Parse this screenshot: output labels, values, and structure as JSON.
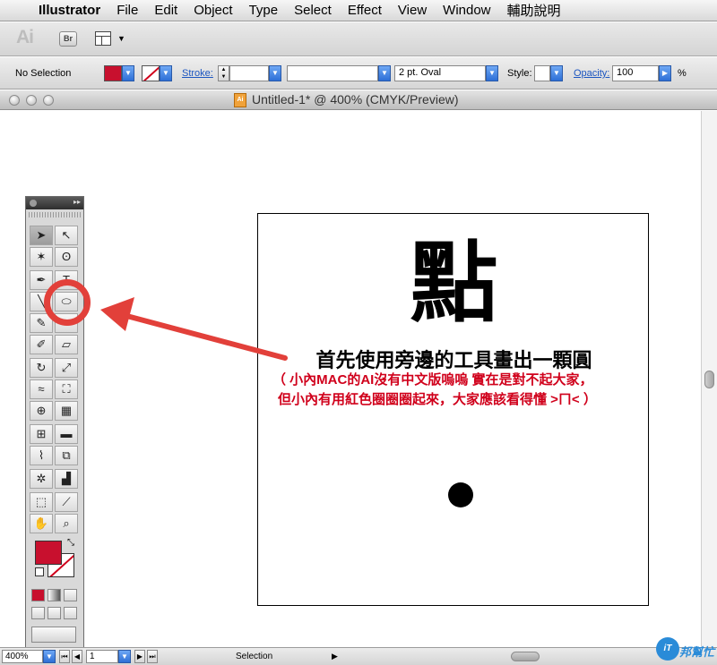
{
  "menubar": {
    "app_name": "Illustrator",
    "items": [
      "File",
      "Edit",
      "Object",
      "Type",
      "Select",
      "Effect",
      "View",
      "Window",
      "輔助說明"
    ]
  },
  "appbar": {
    "logo_text": "Ai",
    "bridge_label": "Br"
  },
  "controlbar": {
    "selection_status": "No Selection",
    "stroke_label": "Stroke:",
    "brush_value": "2 pt. Oval",
    "style_label": "Style:",
    "opacity_label": "Opacity:",
    "opacity_value": "100",
    "opacity_unit": "%",
    "fill_color": "#c8102e"
  },
  "document": {
    "title": "Untitled-1* @ 400% (CMYK/Preview)",
    "icon_label": "Ai"
  },
  "artboard": {
    "big_char": "點",
    "headline": "首先使用旁邊的工具畫出一顆圓",
    "note_line1": "（ 小內MAC的AI沒有中文版嗚嗚 實在是對不起大家，",
    "note_line2": "但小內有用紅色圈圈圈起來，大家應該看得懂 >ㄇ< ）"
  },
  "annotation": {
    "color": "#e2403a"
  },
  "statusbar": {
    "zoom": "400%",
    "artboard_number": "1",
    "status_text": "Selection"
  },
  "watermark": {
    "badge": "iT",
    "text": "邦幫忙"
  }
}
